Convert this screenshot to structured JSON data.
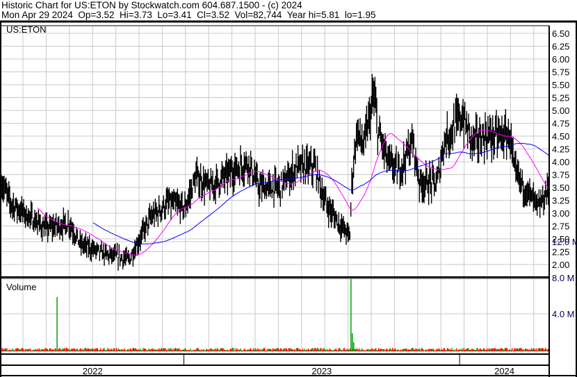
{
  "header": {
    "title": "Historic Chart for US:ETON by Stockwatch.com 604.687.1500 - (c) 2024",
    "quote": "Mon Apr 29 2024  Op=3.52  Hi=3.73  Lo=3.41  Cl=3.52  Vol=82,744  Year hi=5.81  lo=1.95"
  },
  "colors": {
    "bar": "#000000",
    "close_tick": "#ff0000",
    "ma_short": "#ff00ff",
    "ma_long": "#0000ff",
    "vol_up": "#00a000",
    "vol_down": "#ff0000",
    "grid": "#c8c8c8"
  },
  "chart_data": {
    "type": "bar",
    "symbol": "US:ETON",
    "price_axis": {
      "min": 2.0,
      "max": 6.5,
      "step": 0.25,
      "labels": [
        "6.50",
        "6.25",
        "6.00",
        "5.75",
        "5.50",
        "5.25",
        "5.00",
        "4.75",
        "4.50",
        "4.25",
        "4.00",
        "3.75",
        "3.50",
        "3.25",
        "3.00",
        "2.75",
        "2.50",
        "2.25",
        "2.00"
      ]
    },
    "volume_panel": {
      "label": "Volume",
      "labels": [
        "12.0 M",
        "8.0 M",
        "4.0 M"
      ],
      "unit_millions": [
        12,
        8,
        4
      ]
    },
    "x_axis": {
      "start": 2022.338,
      "end": 2024.325,
      "years": [
        "2022",
        "2023",
        "2024"
      ]
    },
    "moving_averages": [
      {
        "name": "short",
        "days": 40
      },
      {
        "name": "long",
        "days": 100
      }
    ],
    "price_path": [
      [
        2022.338,
        3.6
      ],
      [
        2022.371,
        3.2
      ],
      [
        2022.434,
        2.95
      ],
      [
        2022.497,
        2.7
      ],
      [
        2022.586,
        2.8
      ],
      [
        2022.624,
        2.4
      ],
      [
        2022.713,
        2.2
      ],
      [
        2022.802,
        2.1
      ],
      [
        2022.84,
        2.5
      ],
      [
        2022.878,
        2.9
      ],
      [
        2022.942,
        3.2
      ],
      [
        2023.005,
        3.1
      ],
      [
        2023.043,
        3.7
      ],
      [
        2023.094,
        3.5
      ],
      [
        2023.17,
        3.8
      ],
      [
        2023.234,
        4.0
      ],
      [
        2023.272,
        3.5
      ],
      [
        2023.348,
        3.5
      ],
      [
        2023.411,
        3.9
      ],
      [
        2023.475,
        3.9
      ],
      [
        2023.513,
        3.2
      ],
      [
        2023.563,
        2.8
      ],
      [
        2023.602,
        2.55
      ],
      [
        2023.609,
        3.6
      ],
      [
        2023.627,
        4.6
      ],
      [
        2023.652,
        4.3
      ],
      [
        2023.69,
        5.3
      ],
      [
        2023.703,
        4.6
      ],
      [
        2023.741,
        4.0
      ],
      [
        2023.779,
        3.8
      ],
      [
        2023.83,
        4.4
      ],
      [
        2023.855,
        3.6
      ],
      [
        2023.919,
        3.6
      ],
      [
        2023.944,
        4.4
      ],
      [
        2024.008,
        4.9
      ],
      [
        2024.046,
        4.4
      ],
      [
        2024.096,
        4.5
      ],
      [
        2024.185,
        4.5
      ],
      [
        2024.198,
        3.8
      ],
      [
        2024.249,
        3.4
      ],
      [
        2024.287,
        3.1
      ],
      [
        2024.325,
        3.5
      ]
    ],
    "volume_spikes_millions": [
      [
        2022.54,
        6.0
      ],
      [
        2023.606,
        16.0
      ],
      [
        2023.611,
        2.0
      ],
      [
        2023.616,
        1.0
      ]
    ],
    "base_volume_millions": 0.3
  }
}
